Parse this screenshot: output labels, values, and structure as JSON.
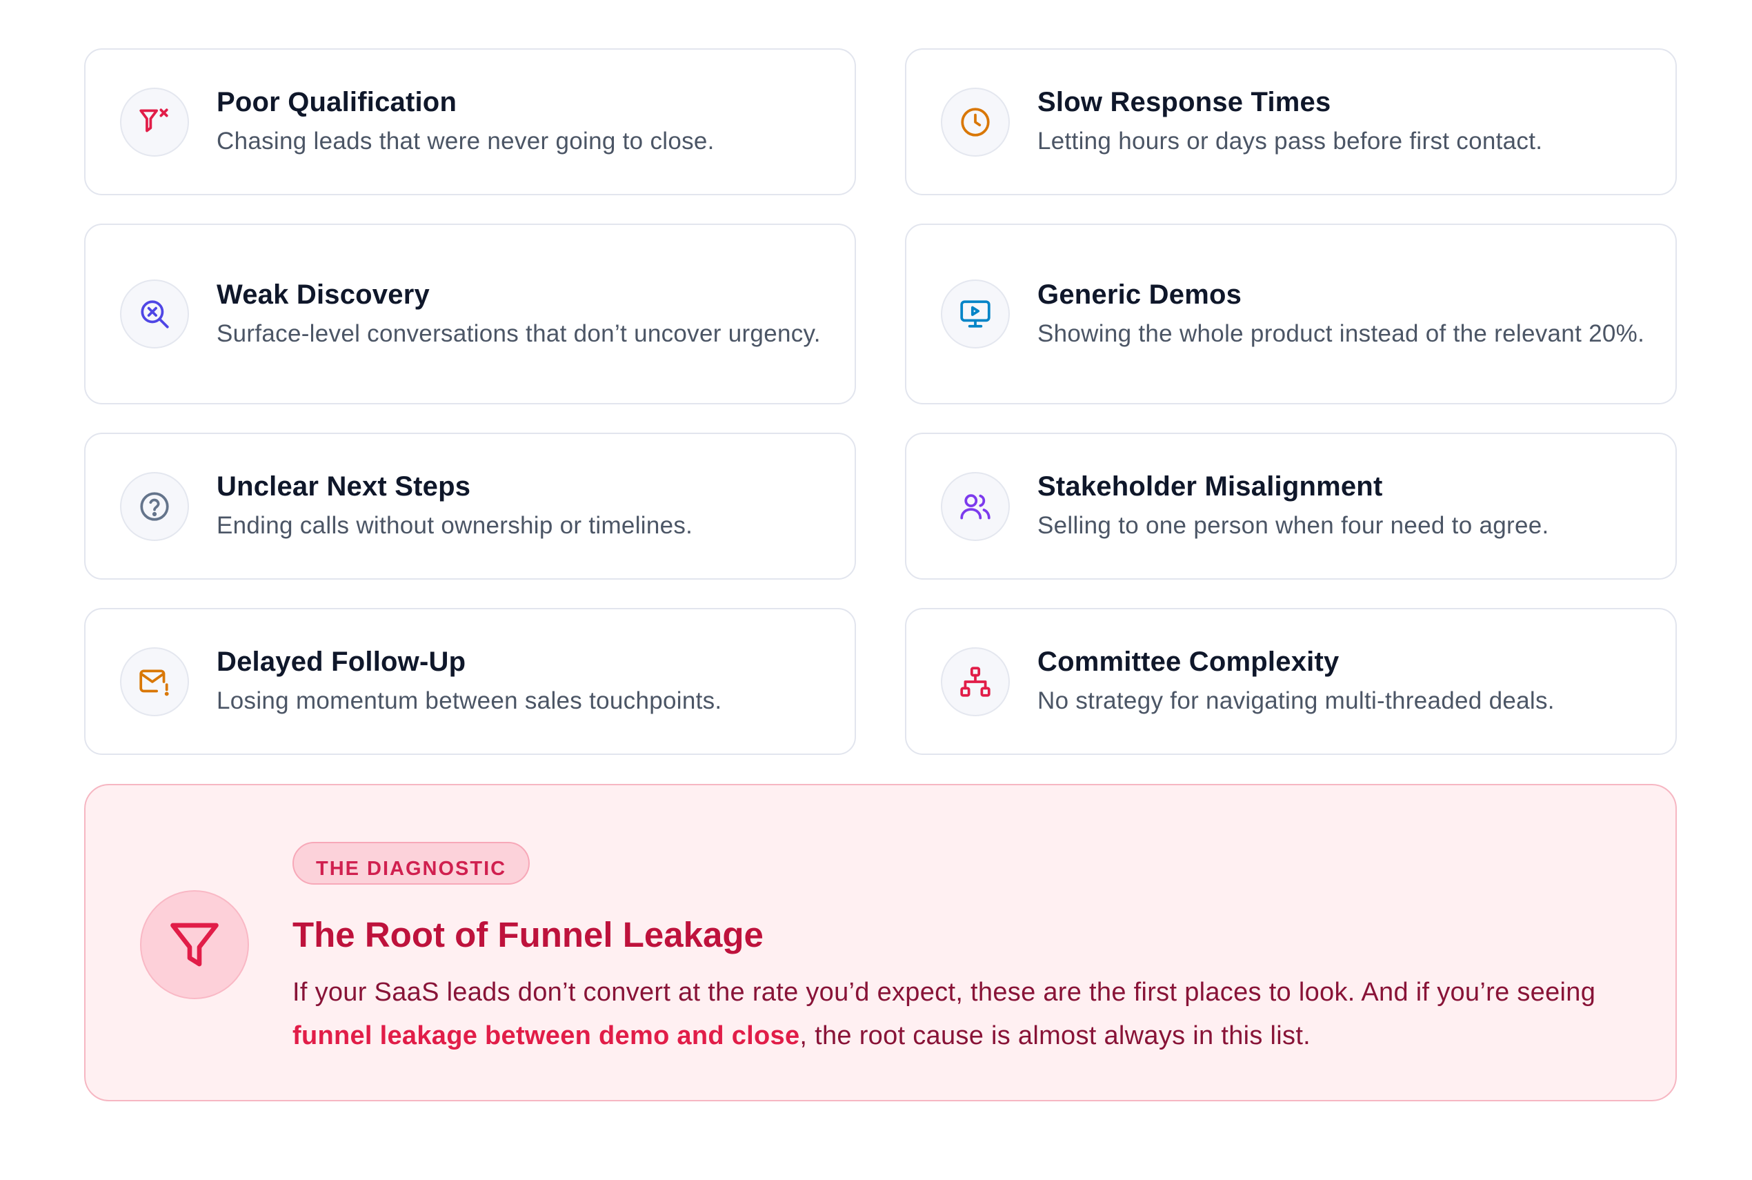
{
  "cards": [
    {
      "title": "Poor Qualification",
      "desc": "Chasing leads that were never going to close.",
      "icon": "filter-x-icon",
      "icon_color": "#e11d48"
    },
    {
      "title": "Slow Response Times",
      "desc": "Letting hours or days pass before first contact.",
      "icon": "clock-icon",
      "icon_color": "#d97706"
    },
    {
      "title": "Weak Discovery",
      "desc": "Surface-level conversations that don’t uncover urgency.",
      "icon": "search-x-icon",
      "icon_color": "#4f46e5"
    },
    {
      "title": "Generic Demos",
      "desc": "Showing the whole product instead of the relevant 20%.",
      "icon": "monitor-play-icon",
      "icon_color": "#0284c7"
    },
    {
      "title": "Unclear Next Steps",
      "desc": "Ending calls without ownership or timelines.",
      "icon": "help-circle-icon",
      "icon_color": "#64748b"
    },
    {
      "title": "Stakeholder Misalignment",
      "desc": "Selling to one person when four need to agree.",
      "icon": "users-icon",
      "icon_color": "#7c3aed"
    },
    {
      "title": "Delayed Follow-Up",
      "desc": "Losing momentum between sales touchpoints.",
      "icon": "mail-warning-icon",
      "icon_color": "#d97706"
    },
    {
      "title": "Committee Complexity",
      "desc": "No strategy for navigating multi-threaded deals.",
      "icon": "network-icon",
      "icon_color": "#e11d48"
    }
  ],
  "diagnostic": {
    "badge": "THE DIAGNOSTIC",
    "title": "The Root of Funnel Leakage",
    "body_before": "If your SaaS leads don’t convert at the rate you’d expect, these are the first places to look. And if you’re seeing ",
    "body_highlight": "funnel leakage between demo and close",
    "body_after": ", the root cause is almost always in this list.",
    "icon": "funnel-icon",
    "accent_color": "#e11d48"
  }
}
